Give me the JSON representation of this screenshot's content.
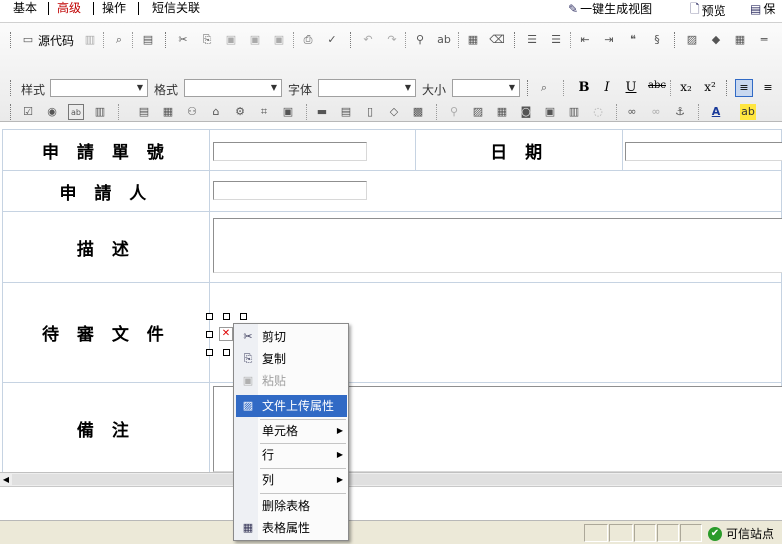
{
  "top_tabs": [
    {
      "label": "基本",
      "active": false
    },
    {
      "label": "高级",
      "active": true
    },
    {
      "label": "操作",
      "active": false
    },
    {
      "label": "短信关联",
      "active": false
    }
  ],
  "top_actions": {
    "generate_view": "一键生成视图",
    "preview": "预览",
    "save_partial": "保"
  },
  "toolbar": {
    "source_label": "源代码",
    "style_label": "样式",
    "format_label": "格式",
    "font_label": "字体",
    "size_label": "大小",
    "bold": "B",
    "italic": "I",
    "underline": "U",
    "strike": "abc",
    "subscript": "x₂",
    "superscript": "x²"
  },
  "form": {
    "rows": [
      {
        "label": "申 請 單 號",
        "label2": "日 期"
      },
      {
        "label": "申 請 人"
      },
      {
        "label": "描   述"
      },
      {
        "label": "待 審 文 件"
      },
      {
        "label": "備     注"
      }
    ]
  },
  "context_menu": {
    "items": [
      {
        "label": "剪切",
        "icon": "scissors-icon",
        "disabled": false
      },
      {
        "label": "复制",
        "icon": "copy-icon",
        "disabled": false
      },
      {
        "label": "粘贴",
        "icon": "paste-icon",
        "disabled": true
      },
      {
        "label": "文件上传属性",
        "icon": "image-properties-icon",
        "highlighted": true
      },
      {
        "label": "单元格",
        "submenu": true
      },
      {
        "label": "行",
        "submenu": true
      },
      {
        "label": "列",
        "submenu": true
      },
      {
        "label": "删除表格"
      },
      {
        "label": "表格属性",
        "icon": "table-icon"
      }
    ]
  },
  "status": {
    "trusted_zone": "可信站点"
  },
  "colors": {
    "active_tab": "#c00000",
    "menu_highlight": "#316ac5",
    "cell_border": "#c6d3e2"
  }
}
